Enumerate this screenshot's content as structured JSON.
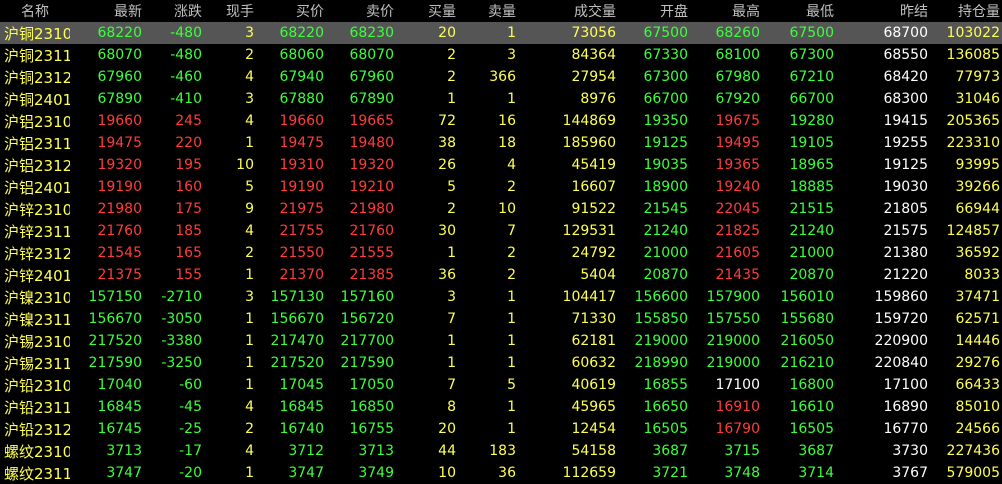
{
  "columns": [
    "名称",
    "最新",
    "涨跌",
    "现手",
    "买价",
    "卖价",
    "买量",
    "卖量",
    "成交量",
    "开盘",
    "最高",
    "最低",
    "昨结",
    "持仓量"
  ],
  "colors": {
    "up": "#ff3c3c",
    "down": "#3cff3c",
    "neutral": "#ffffff",
    "yellow": "#ffff54",
    "cyan": "#54ffff",
    "header": "#c0c0c0",
    "selected": "#555555"
  },
  "rows": [
    {
      "name": "沪铜2310",
      "last": "68220",
      "change": "-480",
      "hand": "3",
      "bid": "68220",
      "ask": "68230",
      "bidvol": "20",
      "askvol": "1",
      "volume": "73056",
      "open": "67500",
      "high": "68260",
      "low": "67500",
      "prev": "68700",
      "oi": "103022",
      "dir": "down"
    },
    {
      "name": "沪铜2311",
      "last": "68070",
      "change": "-480",
      "hand": "2",
      "bid": "68060",
      "ask": "68070",
      "bidvol": "2",
      "askvol": "3",
      "volume": "84364",
      "open": "67330",
      "high": "68100",
      "low": "67300",
      "prev": "68550",
      "oi": "136085",
      "dir": "down"
    },
    {
      "name": "沪铜2312",
      "last": "67960",
      "change": "-460",
      "hand": "4",
      "bid": "67940",
      "ask": "67960",
      "bidvol": "2",
      "askvol": "366",
      "volume": "27954",
      "open": "67300",
      "high": "67980",
      "low": "67210",
      "prev": "68420",
      "oi": "77973",
      "dir": "down"
    },
    {
      "name": "沪铜2401",
      "last": "67890",
      "change": "-410",
      "hand": "3",
      "bid": "67880",
      "ask": "67890",
      "bidvol": "1",
      "askvol": "1",
      "volume": "8976",
      "open": "66700",
      "high": "67920",
      "low": "66700",
      "prev": "68300",
      "oi": "31046",
      "dir": "down"
    },
    {
      "name": "沪铝2310",
      "last": "19660",
      "change": "245",
      "hand": "4",
      "bid": "19660",
      "ask": "19665",
      "bidvol": "72",
      "askvol": "16",
      "volume": "144869",
      "open": "19350",
      "high": "19675",
      "low": "19280",
      "prev": "19415",
      "oi": "205365",
      "dir": "up"
    },
    {
      "name": "沪铝2311",
      "last": "19475",
      "change": "220",
      "hand": "1",
      "bid": "19475",
      "ask": "19480",
      "bidvol": "38",
      "askvol": "18",
      "volume": "185960",
      "open": "19125",
      "high": "19495",
      "low": "19105",
      "prev": "19255",
      "oi": "223310",
      "dir": "up"
    },
    {
      "name": "沪铝2312",
      "last": "19320",
      "change": "195",
      "hand": "10",
      "bid": "19310",
      "ask": "19320",
      "bidvol": "26",
      "askvol": "4",
      "volume": "45419",
      "open": "19035",
      "high": "19365",
      "low": "18965",
      "prev": "19125",
      "oi": "93995",
      "dir": "up"
    },
    {
      "name": "沪铝2401",
      "last": "19190",
      "change": "160",
      "hand": "5",
      "bid": "19190",
      "ask": "19210",
      "bidvol": "5",
      "askvol": "2",
      "volume": "16607",
      "open": "18900",
      "high": "19240",
      "low": "18885",
      "prev": "19030",
      "oi": "39266",
      "dir": "up"
    },
    {
      "name": "沪锌2310",
      "last": "21980",
      "change": "175",
      "hand": "9",
      "bid": "21975",
      "ask": "21980",
      "bidvol": "2",
      "askvol": "10",
      "volume": "91522",
      "open": "21545",
      "high": "22045",
      "low": "21515",
      "prev": "21805",
      "oi": "66944",
      "dir": "up"
    },
    {
      "name": "沪锌2311",
      "last": "21760",
      "change": "185",
      "hand": "4",
      "bid": "21755",
      "ask": "21760",
      "bidvol": "30",
      "askvol": "7",
      "volume": "129531",
      "open": "21240",
      "high": "21825",
      "low": "21240",
      "prev": "21575",
      "oi": "124857",
      "dir": "up"
    },
    {
      "name": "沪锌2312",
      "last": "21545",
      "change": "165",
      "hand": "2",
      "bid": "21550",
      "ask": "21555",
      "bidvol": "1",
      "askvol": "2",
      "volume": "24792",
      "open": "21000",
      "high": "21605",
      "low": "21000",
      "prev": "21380",
      "oi": "36592",
      "dir": "up"
    },
    {
      "name": "沪锌2401",
      "last": "21375",
      "change": "155",
      "hand": "1",
      "bid": "21370",
      "ask": "21385",
      "bidvol": "36",
      "askvol": "2",
      "volume": "5404",
      "open": "20870",
      "high": "21435",
      "low": "20870",
      "prev": "21220",
      "oi": "8033",
      "dir": "up"
    },
    {
      "name": "沪镍2310",
      "last": "157150",
      "change": "-2710",
      "hand": "3",
      "bid": "157130",
      "ask": "157160",
      "bidvol": "3",
      "askvol": "1",
      "volume": "104417",
      "open": "156600",
      "high": "157900",
      "low": "156010",
      "prev": "159860",
      "oi": "37471",
      "dir": "down"
    },
    {
      "name": "沪镍2311",
      "last": "156670",
      "change": "-3050",
      "hand": "1",
      "bid": "156670",
      "ask": "156720",
      "bidvol": "7",
      "askvol": "1",
      "volume": "71330",
      "open": "155850",
      "high": "157550",
      "low": "155680",
      "prev": "159720",
      "oi": "62571",
      "dir": "down"
    },
    {
      "name": "沪锡2310",
      "last": "217520",
      "change": "-3380",
      "hand": "1",
      "bid": "217470",
      "ask": "217700",
      "bidvol": "1",
      "askvol": "1",
      "volume": "62181",
      "open": "219000",
      "high": "219000",
      "low": "216050",
      "prev": "220900",
      "oi": "14446",
      "dir": "down"
    },
    {
      "name": "沪锡2311",
      "last": "217590",
      "change": "-3250",
      "hand": "1",
      "bid": "217520",
      "ask": "217590",
      "bidvol": "1",
      "askvol": "1",
      "volume": "60632",
      "open": "218990",
      "high": "219000",
      "low": "216210",
      "prev": "220840",
      "oi": "29276",
      "dir": "down"
    },
    {
      "name": "沪铅2310",
      "last": "17040",
      "change": "-60",
      "hand": "1",
      "bid": "17045",
      "ask": "17050",
      "bidvol": "7",
      "askvol": "5",
      "volume": "40619",
      "open": "16855",
      "high": "17100",
      "low": "16800",
      "prev": "17100",
      "oi": "66433",
      "dir": "down"
    },
    {
      "name": "沪铅2311",
      "last": "16845",
      "change": "-45",
      "hand": "4",
      "bid": "16845",
      "ask": "16850",
      "bidvol": "8",
      "askvol": "1",
      "volume": "45965",
      "open": "16650",
      "high": "16910",
      "low": "16610",
      "prev": "16890",
      "oi": "85010",
      "dir": "down"
    },
    {
      "name": "沪铅2312",
      "last": "16745",
      "change": "-25",
      "hand": "2",
      "bid": "16740",
      "ask": "16755",
      "bidvol": "20",
      "askvol": "1",
      "volume": "12454",
      "open": "16505",
      "high": "16790",
      "low": "16505",
      "prev": "16770",
      "oi": "24566",
      "dir": "down"
    },
    {
      "name": "螺纹2310",
      "last": "3713",
      "change": "-17",
      "hand": "4",
      "bid": "3712",
      "ask": "3713",
      "bidvol": "44",
      "askvol": "183",
      "volume": "54158",
      "open": "3687",
      "high": "3715",
      "low": "3687",
      "prev": "3730",
      "oi": "227436",
      "dir": "down"
    },
    {
      "name": "螺纹2311",
      "last": "3747",
      "change": "-20",
      "hand": "1",
      "bid": "3747",
      "ask": "3749",
      "bidvol": "10",
      "askvol": "36",
      "volume": "112659",
      "open": "3721",
      "high": "3748",
      "low": "3714",
      "prev": "3767",
      "oi": "579005",
      "dir": "down"
    }
  ]
}
